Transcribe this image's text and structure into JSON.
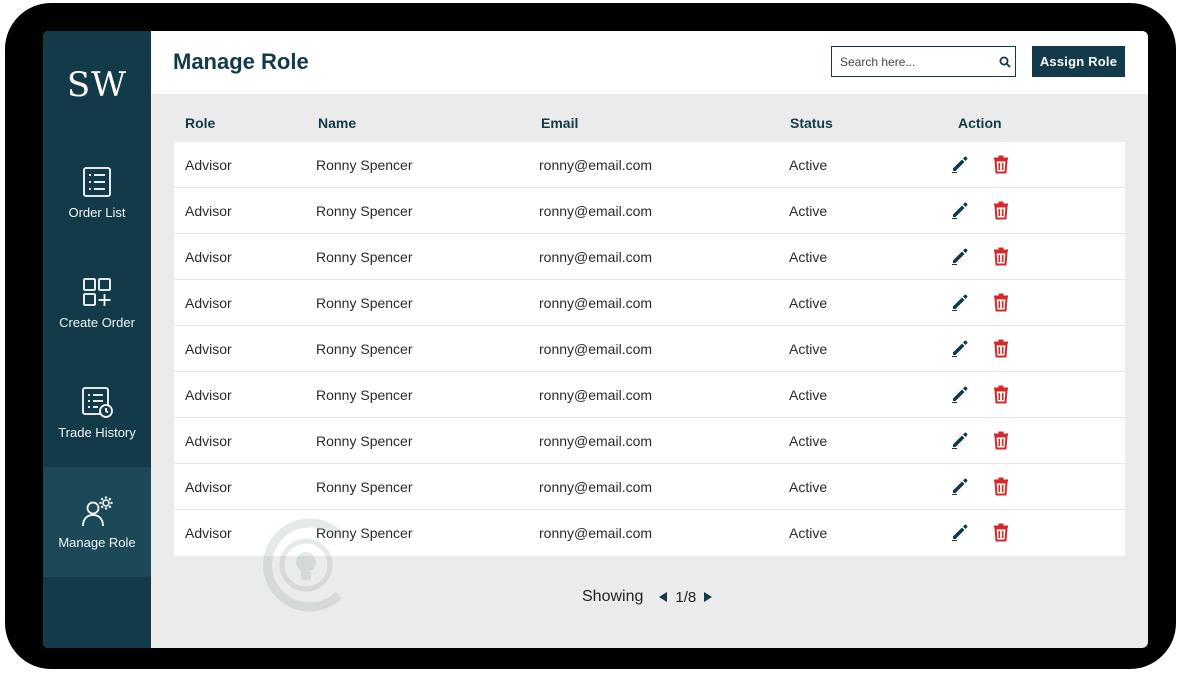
{
  "brand": {
    "logo": "SW"
  },
  "sidebar": {
    "items": [
      {
        "label": "Order List",
        "icon": "list-icon",
        "active": false
      },
      {
        "label": "Create Order",
        "icon": "grid-plus-icon",
        "active": false
      },
      {
        "label": "Trade History",
        "icon": "history-icon",
        "active": false
      },
      {
        "label": "Manage Role",
        "icon": "user-gear-icon",
        "active": true
      }
    ]
  },
  "header": {
    "title": "Manage Role",
    "search_placeholder": "Search here...",
    "assign_label": "Assign  Role"
  },
  "table": {
    "columns": [
      "Role",
      "Name",
      "Email",
      "Status",
      "Action"
    ],
    "rows": [
      {
        "role": "Advisor",
        "name": "Ronny Spencer",
        "email": "ronny@email.com",
        "status": "Active"
      },
      {
        "role": "Advisor",
        "name": "Ronny Spencer",
        "email": "ronny@email.com",
        "status": "Active"
      },
      {
        "role": "Advisor",
        "name": "Ronny Spencer",
        "email": "ronny@email.com",
        "status": "Active"
      },
      {
        "role": "Advisor",
        "name": "Ronny Spencer",
        "email": "ronny@email.com",
        "status": "Active"
      },
      {
        "role": "Advisor",
        "name": "Ronny Spencer",
        "email": "ronny@email.com",
        "status": "Active"
      },
      {
        "role": "Advisor",
        "name": "Ronny Spencer",
        "email": "ronny@email.com",
        "status": "Active"
      },
      {
        "role": "Advisor",
        "name": "Ronny Spencer",
        "email": "ronny@email.com",
        "status": "Active"
      },
      {
        "role": "Advisor",
        "name": "Ronny Spencer",
        "email": "ronny@email.com",
        "status": "Active"
      },
      {
        "role": "Advisor",
        "name": "Ronny Spencer",
        "email": "ronny@email.com",
        "status": "Active"
      }
    ]
  },
  "pagination": {
    "showing_label": "Showing",
    "page": "1/8"
  },
  "colors": {
    "primary": "#133a48",
    "active_nav": "#1b4957",
    "delete": "#d62828",
    "background": "#ebebeb"
  }
}
